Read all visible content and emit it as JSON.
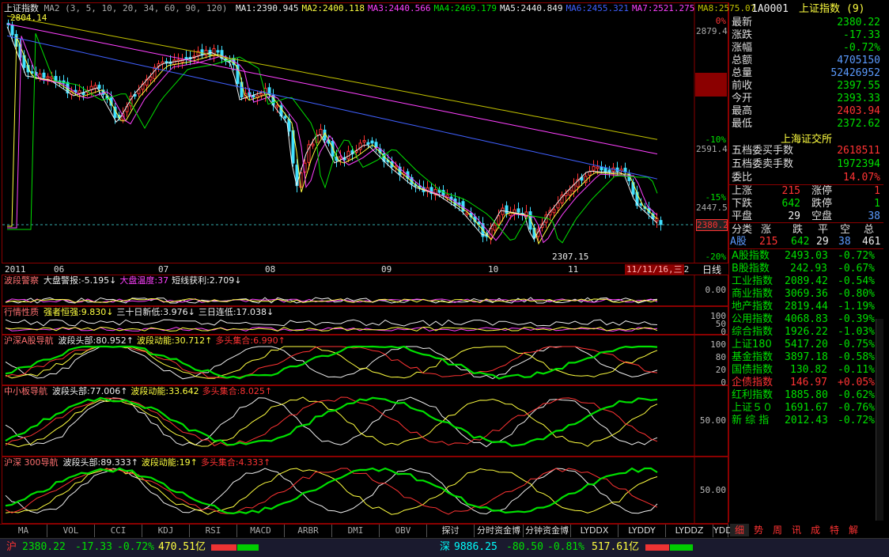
{
  "chart": {
    "title": "上证指数",
    "ma_params": "MA2 (3, 5, 10, 20, 34, 60, 90, 120)",
    "ma_values": [
      {
        "label": "MA1:2390.945",
        "color": "#eeeeee"
      },
      {
        "label": "MA2:2400.118",
        "color": "#ffff40"
      },
      {
        "label": "MA3:2440.566",
        "color": "#ff40ff"
      },
      {
        "label": "MA4:2469.179",
        "color": "#00e000"
      },
      {
        "label": "MA5:2440.849",
        "color": "#eeeeee"
      },
      {
        "label": "MA6:2455.321",
        "color": "#4060ff"
      },
      {
        "label": "MA7:2521.275",
        "color": "#ff40ff"
      },
      {
        "label": "MA8:2575.07",
        "color": "#c0c000"
      }
    ],
    "high_marker": "2804.14",
    "low_marker": "2307.15",
    "current_price_tag": "2380.2",
    "date_label": "11/11/16,三",
    "period_label": "日线",
    "months": [
      "2011",
      "06",
      "07",
      "08",
      "09",
      "10",
      "11",
      "12"
    ],
    "right_scale": [
      {
        "label": "0%",
        "color": "#ff3333"
      },
      {
        "label": "2879.4",
        "color": "#aaaaaa"
      },
      {
        "label": "-10%",
        "color": "#00e000"
      },
      {
        "label": "2591.4",
        "color": "#aaaaaa"
      },
      {
        "label": "-15%",
        "color": "#00e000"
      },
      {
        "label": "2447.5",
        "color": "#aaaaaa"
      },
      {
        "label": "-20%",
        "color": "#00e000"
      }
    ]
  },
  "indicators": [
    {
      "name": "波段警察",
      "items": [
        {
          "t": "大盘警报:-5.195↓",
          "c": "#eeeeee"
        },
        {
          "t": "大盘温度:37",
          "c": "#ff40ff"
        },
        {
          "t": "短线获利:2.709↓",
          "c": "#eeeeee"
        }
      ],
      "scale": [
        "0.00"
      ]
    },
    {
      "name": "行情性质",
      "items": [
        {
          "t": "强者恒强:9.830↓",
          "c": "#ffff40"
        },
        {
          "t": "三十日新低:3.976↓",
          "c": "#eeeeee"
        },
        {
          "t": "三日连低:17.038↓",
          "c": "#eeeeee"
        }
      ],
      "scale": [
        "100",
        "50",
        "0"
      ]
    },
    {
      "name": "沪深A股导航",
      "items": [
        {
          "t": "波段头部:80.952↑",
          "c": "#eeeeee"
        },
        {
          "t": "波段动能:30.712↑",
          "c": "#ffff40"
        },
        {
          "t": "多头集合:6.990↑",
          "c": "#ff3333"
        }
      ],
      "scale": [
        "100",
        "80",
        "20",
        "0"
      ]
    },
    {
      "name": "中小板导航",
      "items": [
        {
          "t": "波段头部:77.006↑",
          "c": "#eeeeee"
        },
        {
          "t": "波段动能:33.642",
          "c": "#ffff40"
        },
        {
          "t": "多头集合:8.025↑",
          "c": "#ff3333"
        }
      ],
      "scale": [
        "50.00"
      ]
    },
    {
      "name": "沪深 300导航",
      "items": [
        {
          "t": "波段头部:89.333↑",
          "c": "#eeeeee"
        },
        {
          "t": "波段动能:19↑",
          "c": "#ffff40"
        },
        {
          "t": "多头集合:4.333↑",
          "c": "#ff3333"
        }
      ],
      "scale": [
        "50.00"
      ]
    }
  ],
  "quote": {
    "code": "1A0001",
    "name": "上证指数",
    "count": "(9)",
    "fields": [
      {
        "k": "最新",
        "v": "2380.22",
        "c": "#00e000"
      },
      {
        "k": "涨跌",
        "v": "-17.33",
        "c": "#00e000"
      },
      {
        "k": "涨幅",
        "v": "-0.72%",
        "c": "#00e000"
      },
      {
        "k": "总额",
        "v": "4705150",
        "c": "#5b9bff"
      },
      {
        "k": "总量",
        "v": "52426952",
        "c": "#5b9bff"
      },
      {
        "k": "前收",
        "v": "2397.55",
        "c": "#00e000"
      },
      {
        "k": "今开",
        "v": "2393.33",
        "c": "#00e000"
      },
      {
        "k": "最高",
        "v": "2403.94",
        "c": "#ff3333"
      },
      {
        "k": "最低",
        "v": "2372.62",
        "c": "#00e000"
      }
    ],
    "exchange": "上海证交所",
    "bid_label": "五档委买手数",
    "bid_value": "2618511",
    "ask_label": "五档委卖手数",
    "ask_value": "1972394",
    "ratio_label": "委比",
    "ratio_value": "14.07%",
    "breadth": [
      {
        "k1": "上涨",
        "v1": "215",
        "k2": "涨停",
        "v2": "1"
      },
      {
        "k1": "下跌",
        "v1": "642",
        "k2": "跌停",
        "v2": "1"
      },
      {
        "k1": "平盘",
        "v1": "29",
        "k2": "空盘",
        "v2": "38"
      }
    ],
    "cls_headers": [
      "分类",
      "涨",
      "跌",
      "平",
      "空",
      "总"
    ],
    "cls_row": [
      "A股",
      "215",
      "642",
      "29",
      "38",
      "461"
    ],
    "indices": [
      {
        "k": "A股指数",
        "v": "2493.03",
        "p": "-0.72%",
        "c": "#00e000"
      },
      {
        "k": "B股指数",
        "v": "242.93",
        "p": "-0.67%",
        "c": "#00e000"
      },
      {
        "k": "工业指数",
        "v": "2089.42",
        "p": "-0.54%",
        "c": "#00e000"
      },
      {
        "k": "商业指数",
        "v": "3069.36",
        "p": "-0.80%",
        "c": "#00e000"
      },
      {
        "k": "地产指数",
        "v": "2819.44",
        "p": "-1.19%",
        "c": "#00e000"
      },
      {
        "k": "公用指数",
        "v": "4068.83",
        "p": "-0.39%",
        "c": "#00e000"
      },
      {
        "k": "综合指数",
        "v": "1926.22",
        "p": "-1.03%",
        "c": "#00e000"
      },
      {
        "k": "上证180",
        "v": "5417.20",
        "p": "-0.75%",
        "c": "#00e000"
      },
      {
        "k": "基金指数",
        "v": "3897.18",
        "p": "-0.58%",
        "c": "#00e000"
      },
      {
        "k": "国债指数",
        "v": "130.82",
        "p": "-0.11%",
        "c": "#00e000"
      },
      {
        "k": "企债指数",
        "v": "146.97",
        "p": "+0.05%",
        "c": "#ff3333"
      },
      {
        "k": "红利指数",
        "v": "1885.80",
        "p": "-0.62%",
        "c": "#00e000"
      },
      {
        "k": "上证５０",
        "v": "1691.67",
        "p": "-0.76%",
        "c": "#00e000"
      },
      {
        "k": "新 综 指",
        "v": "2012.43",
        "p": "-0.72%",
        "c": "#00e000"
      }
    ]
  },
  "tabs": [
    "MA",
    "VOL",
    "CCI",
    "KDJ",
    "RSI",
    "MACD",
    "ARBR",
    "DMI",
    "OBV",
    "探讨",
    "分时资金博",
    "分钟资金博",
    "LYDDX",
    "LYDDY",
    "LYDDZ",
    "YDD"
  ],
  "right_tabs": [
    "细",
    "势",
    "周",
    "讯",
    "成",
    "特",
    "解"
  ],
  "status": {
    "sh_label": "沪",
    "sh_price": "2380.22",
    "sh_change": "-17.33",
    "sh_pct": "-0.72%",
    "sh_amount": "470.51亿",
    "sz_label": "深",
    "sz_price": "9886.25",
    "sz_change": "-80.50",
    "sz_pct": "-0.81%",
    "sz_amount": "517.61亿"
  }
}
